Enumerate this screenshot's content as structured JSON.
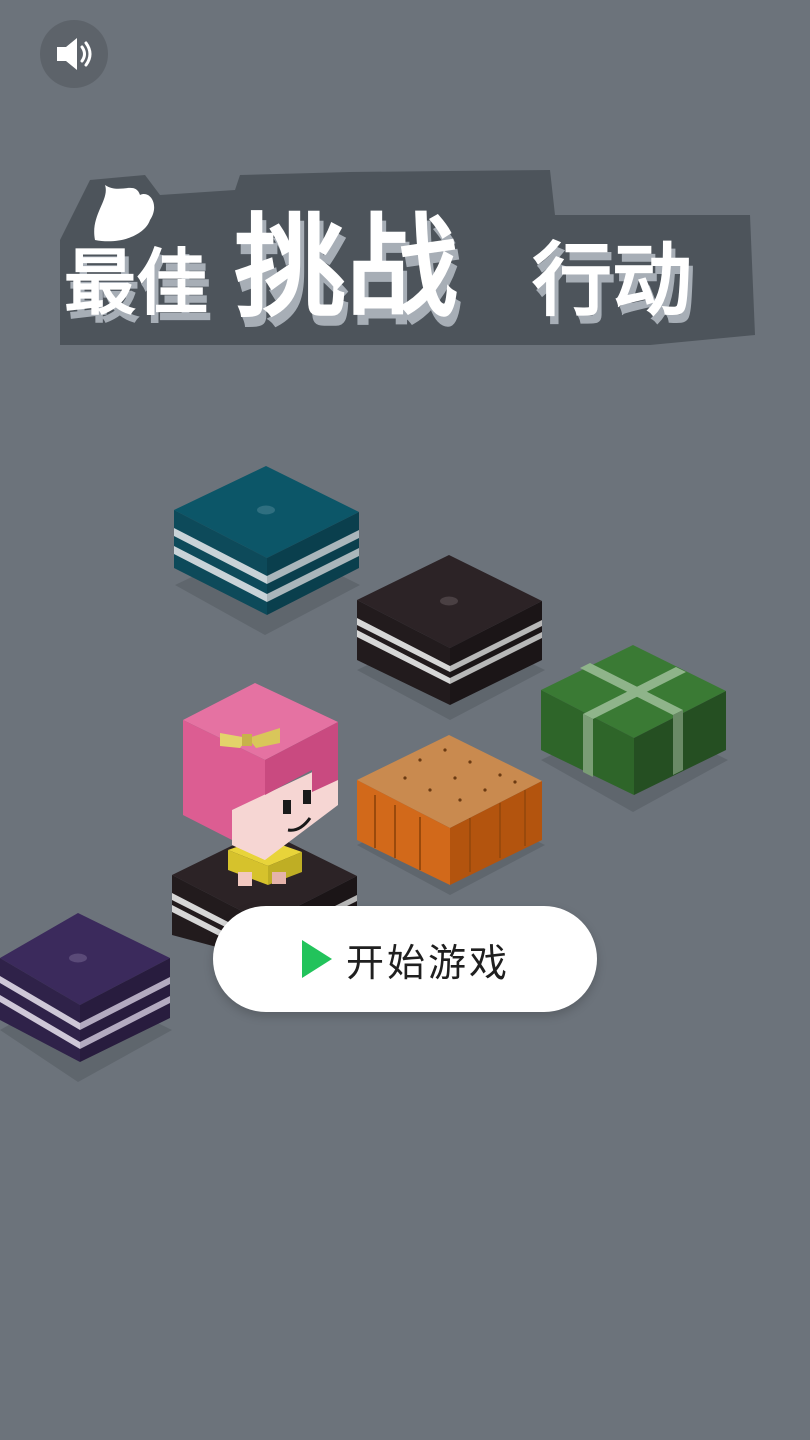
{
  "sound": {
    "icon": "speaker-volume-icon"
  },
  "title": {
    "part1": "最佳",
    "part2": "挑战",
    "part3": "行动",
    "full": "最佳挑战行动"
  },
  "start_button": {
    "label": "开始游戏",
    "icon": "play-triangle-icon",
    "icon_color": "#22c35b"
  },
  "colors": {
    "background": "#6c737b",
    "block_teal": "#0f5a6e",
    "block_black": "#2b2224",
    "block_green": "#2f6a2c",
    "block_orange": "#d0660e",
    "block_purple": "#3b2a5c",
    "character_hair": "#e0628f"
  }
}
